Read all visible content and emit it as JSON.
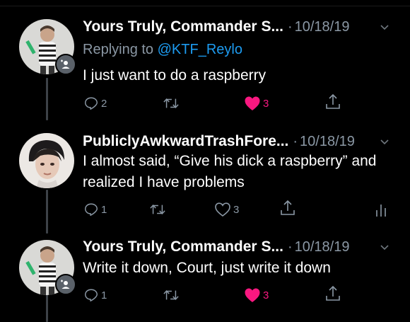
{
  "tweets": [
    {
      "name": "Yours Truly, Commander S...",
      "date": "10/18/19",
      "replying_prefix": "Replying to ",
      "replying_handle": "@KTF_Reylo",
      "text": "I just want to do a raspberry",
      "replies": "2",
      "retweets": "",
      "likes": "3",
      "liked": true
    },
    {
      "name": "PubliclyAwkwardTrashFore...",
      "date": "10/18/19",
      "text": "I almost said, “Give his dick a raspberry” and realized I have problems",
      "replies": "1",
      "retweets": "",
      "likes": "3",
      "liked": false
    },
    {
      "name": "Yours Truly, Commander S...",
      "date": "10/18/19",
      "text": "Write it down, Court, just write it down",
      "replies": "1",
      "retweets": "",
      "likes": "3",
      "liked": true
    }
  ],
  "icons": {
    "reply": "reply-icon",
    "retweet": "retweet-icon",
    "like": "heart-icon",
    "share": "share-icon",
    "analytics": "analytics-icon",
    "more": "chevron-down-icon",
    "follow_badge": "person-badge-icon"
  },
  "colors": {
    "background": "#000000",
    "text": "#ffffff",
    "muted": "#8b98a5",
    "link": "#1d9bf0",
    "like": "#f91880",
    "thread_line": "#3d4248"
  }
}
